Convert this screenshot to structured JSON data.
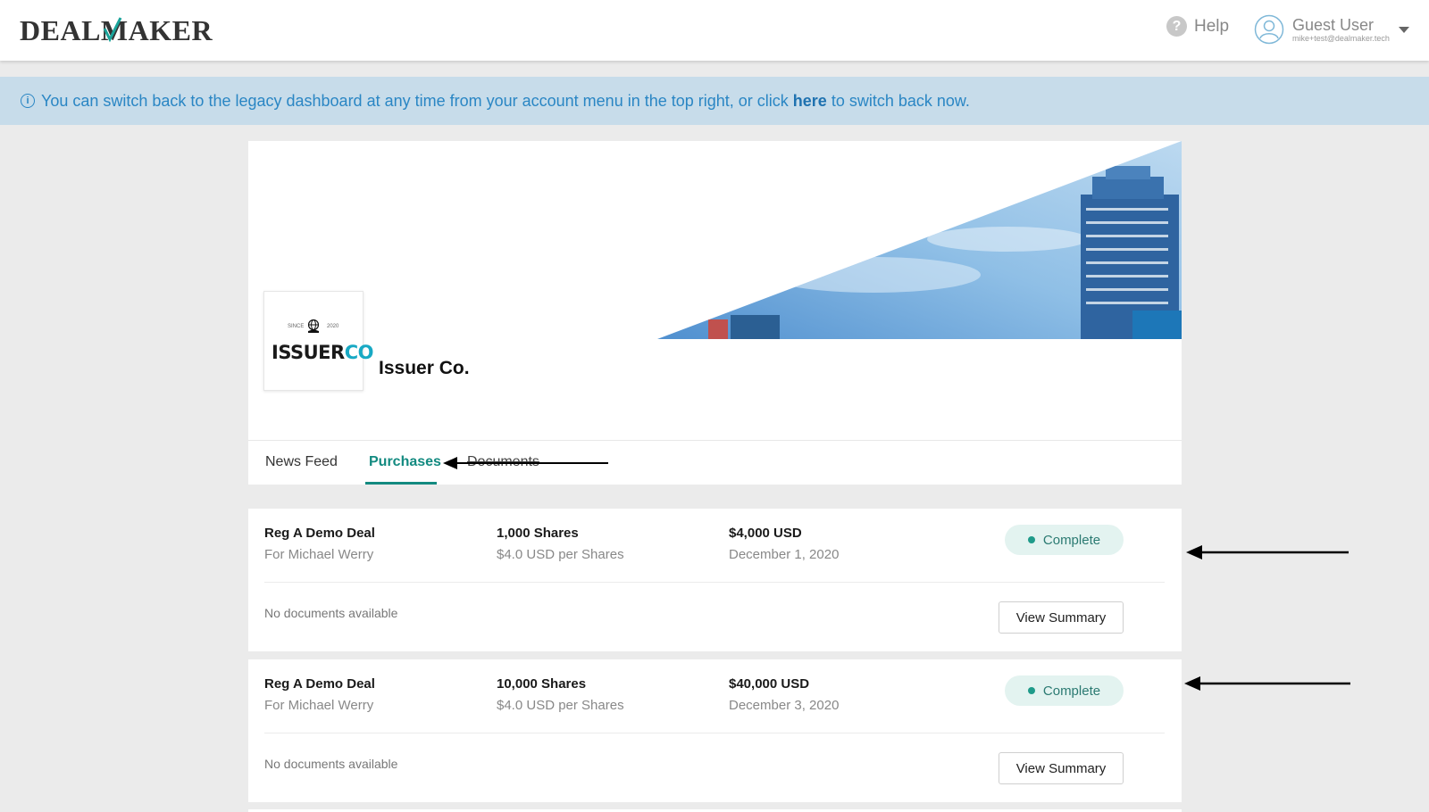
{
  "header": {
    "brand_left": "DEAL",
    "brand_right": "AKER",
    "help_label": "Help",
    "user_name": "Guest User",
    "user_email": "mike+test@dealmaker.tech"
  },
  "banner": {
    "text_before": "You can switch back to the legacy dashboard at any time from your account menu in the top right, or click ",
    "link": "here",
    "text_after": " to switch back now."
  },
  "profile": {
    "logo_since": "SINCE",
    "logo_year": "2020",
    "logo_main": "ISSUER",
    "logo_accent": "CO",
    "company_name": "Issuer Co.",
    "tabs": [
      "News Feed",
      "Purchases",
      "Documents"
    ],
    "active_tab": "Purchases"
  },
  "purchases": [
    {
      "deal": "Reg A Demo Deal",
      "investor": "For Michael Werry",
      "shares": "1,000 Shares",
      "price": "$4.0 USD per Shares",
      "amount": "$4,000 USD",
      "date": "December 1, 2020",
      "status": "Complete",
      "docs": "No documents available",
      "button": "View Summary"
    },
    {
      "deal": "Reg A Demo Deal",
      "investor": "For Michael Werry",
      "shares": "10,000 Shares",
      "price": "$4.0 USD per Shares",
      "amount": "$40,000 USD",
      "date": "December 3, 2020",
      "status": "Complete",
      "docs": "No documents available",
      "button": "View Summary"
    }
  ],
  "colors": {
    "accent": "#138a80",
    "banner_bg": "#c7dcea",
    "banner_text": "#2a86c4",
    "status_bg": "#e3f3f0"
  }
}
